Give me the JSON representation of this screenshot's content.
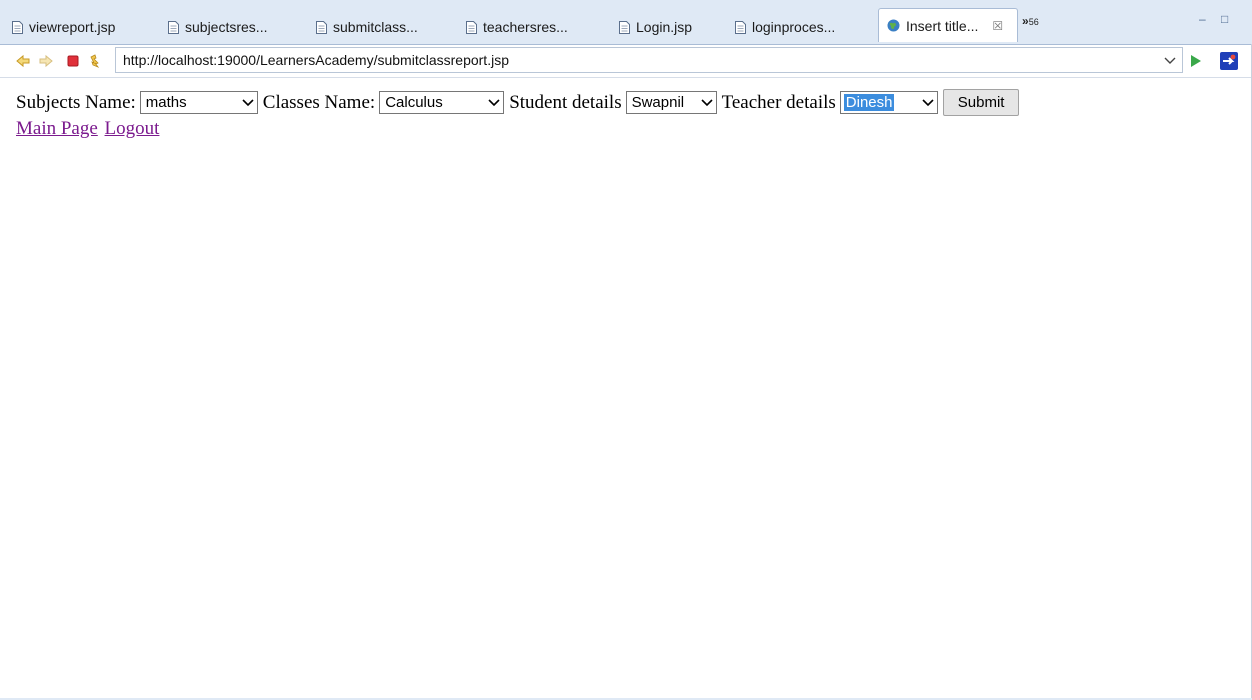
{
  "tabs": [
    {
      "label": "viewreport.jsp",
      "icon": "jsp-file-icon"
    },
    {
      "label": "subjectsres...",
      "icon": "jsp-file-icon"
    },
    {
      "label": "submitclass...",
      "icon": "jsp-file-icon"
    },
    {
      "label": "teachersres...",
      "icon": "jsp-file-icon"
    },
    {
      "label": "Login.jsp",
      "icon": "jsp-file-icon"
    },
    {
      "label": "loginproces...",
      "icon": "jsp-file-icon"
    },
    {
      "label": "Insert title...",
      "icon": "globe-icon",
      "active": true,
      "close": "☒"
    }
  ],
  "tab_overflow": {
    "chevrons": "»",
    "count": "56"
  },
  "window_controls": {
    "minimize": "–",
    "maximize": "□"
  },
  "url_bar": {
    "value": "http://localhost:19000/LearnersAcademy/submitclassreport.jsp"
  },
  "form": {
    "subjects_label": "Subjects Name:",
    "subjects_value": "maths",
    "classes_label": "Classes Name:",
    "classes_value": "Calculus",
    "student_label": "Student details",
    "student_value": "Swapnil",
    "teacher_label": "Teacher details",
    "teacher_value": "Dinesh",
    "submit_label": "Submit"
  },
  "links": {
    "main_page": "Main Page",
    "logout": "Logout"
  },
  "colors": {
    "tab_strip": "#dfe9f5",
    "link_visited": "#7b1a8e",
    "select_highlight": "#3c8dde",
    "stop_red": "#e0303a",
    "go_green": "#3aa84a"
  }
}
